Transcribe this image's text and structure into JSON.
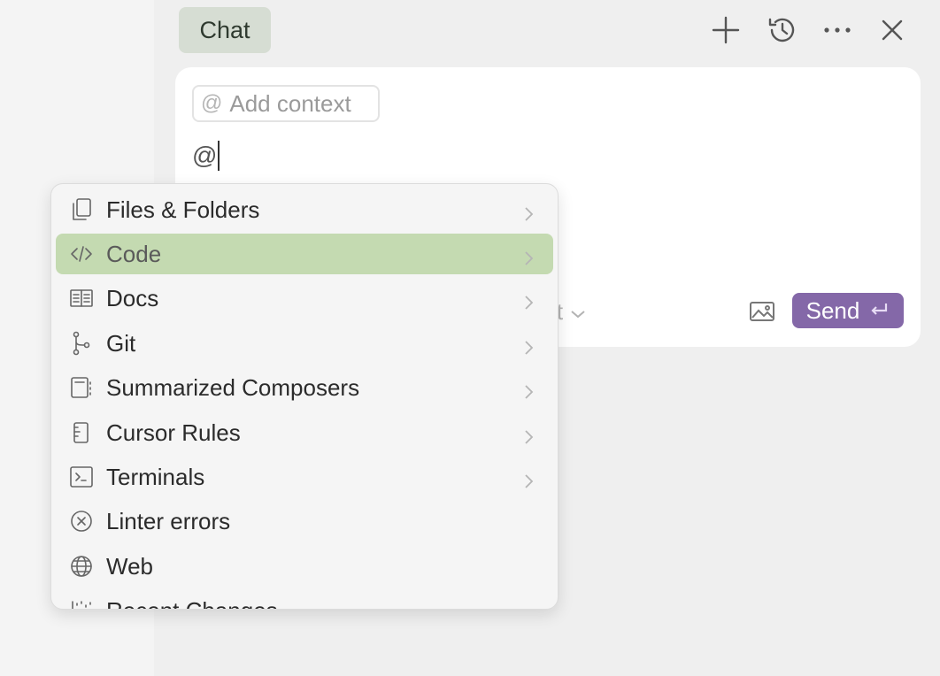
{
  "header": {
    "tab_label": "Chat",
    "icons": [
      "plus-icon",
      "history-icon",
      "more-icon",
      "close-icon"
    ]
  },
  "composer": {
    "add_context_label": "Add context",
    "add_context_icon": "at-sign-icon",
    "input_text": "@",
    "model_partial": "net",
    "send_label": "Send",
    "send_icon": "enter-icon",
    "accent_color": "#8468a8"
  },
  "mention_menu": {
    "highlight_color": "#c4dab1",
    "items": [
      {
        "label": "Files & Folders",
        "icon": "files-icon",
        "has_submenu": true
      },
      {
        "label": "Code",
        "icon": "code-icon",
        "has_submenu": true,
        "active": true
      },
      {
        "label": "Docs",
        "icon": "book-icon",
        "has_submenu": true
      },
      {
        "label": "Git",
        "icon": "git-branch-icon",
        "has_submenu": true
      },
      {
        "label": "Summarized Composers",
        "icon": "notebook-icon",
        "has_submenu": true
      },
      {
        "label": "Cursor Rules",
        "icon": "ruler-icon",
        "has_submenu": true
      },
      {
        "label": "Terminals",
        "icon": "terminal-icon",
        "has_submenu": true
      },
      {
        "label": "Linter errors",
        "icon": "circle-x-icon",
        "has_submenu": false
      },
      {
        "label": "Web",
        "icon": "globe-icon",
        "has_submenu": false
      },
      {
        "label": "Recent Changes",
        "icon": "recent-changes-icon",
        "has_submenu": false
      }
    ]
  }
}
